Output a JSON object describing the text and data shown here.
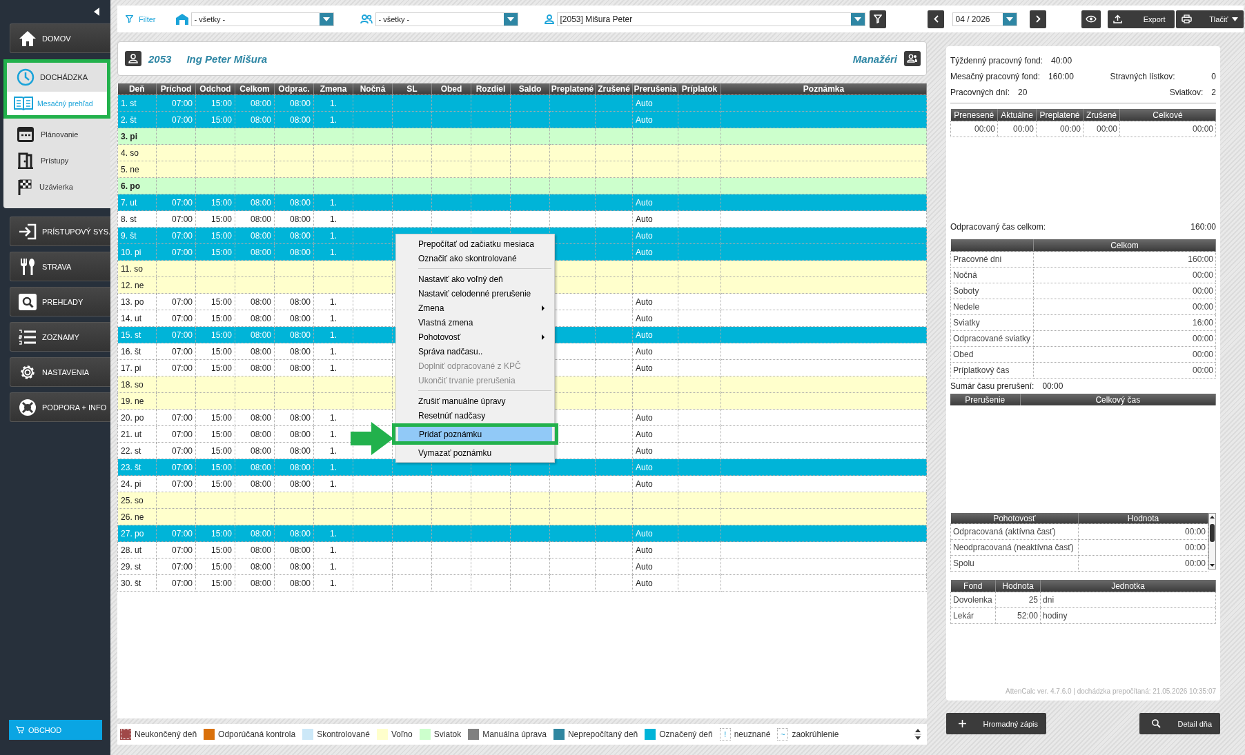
{
  "nav": [
    {
      "label": "DOMOV",
      "expanded": false
    },
    {
      "label": "DOCHÁDZKA",
      "expanded": true,
      "children": [
        {
          "label": "Mesačný prehľad",
          "selected": true
        },
        {
          "label": "Plánovanie",
          "selected": false
        },
        {
          "label": "Prístupy",
          "selected": false
        },
        {
          "label": "Uzávierka",
          "selected": false
        }
      ]
    },
    {
      "label": "PRÍSTUPOVÝ SYS.",
      "expanded": false
    },
    {
      "label": "STRAVA",
      "expanded": false
    },
    {
      "label": "PREHĽADY",
      "expanded": false
    },
    {
      "label": "ZOZNAMY",
      "expanded": false
    },
    {
      "label": "NASTAVENIA",
      "expanded": false
    },
    {
      "label": "PODPORA + INFO",
      "expanded": false
    }
  ],
  "shop_button": "OBCHOD",
  "toolbar": {
    "filter_label": "Filter",
    "location_select": "- všetky -",
    "group_select": "- všetky -",
    "employee_select": "[2053] Mišura Peter",
    "month": "04 / 2026",
    "export_label": "Export",
    "print_label": "Tlačiť"
  },
  "employee": {
    "id": "2053",
    "name": "Ing Peter Mišura",
    "managers_label": "Manažéri"
  },
  "table": {
    "columns": [
      "Deň",
      "Príchod",
      "Odchod",
      "Celkom",
      "Odprac.",
      "Zmena",
      "Nočná",
      "SL",
      "Obed",
      "Rozdiel",
      "Saldo",
      "Preplatené",
      "Zrušené",
      "Prerušenia",
      "Príplatok",
      "Poznámka"
    ],
    "rows": [
      {
        "day": "1. st",
        "kind": "marked",
        "arrival": "07:00",
        "departure": "15:00",
        "total": "08:00",
        "worked": "08:00",
        "shift": "1.",
        "interruption": "Auto"
      },
      {
        "day": "2. št",
        "kind": "marked",
        "arrival": "07:00",
        "departure": "15:00",
        "total": "08:00",
        "worked": "08:00",
        "shift": "1.",
        "interruption": "Auto"
      },
      {
        "day": "3. pi",
        "kind": "holiday"
      },
      {
        "day": "4. so",
        "kind": "free"
      },
      {
        "day": "5. ne",
        "kind": "free"
      },
      {
        "day": "6. po",
        "kind": "holiday"
      },
      {
        "day": "7. ut",
        "kind": "marked",
        "arrival": "07:00",
        "departure": "15:00",
        "total": "08:00",
        "worked": "08:00",
        "shift": "1.",
        "interruption": "Auto"
      },
      {
        "day": "8. st",
        "kind": "normal",
        "arrival": "07:00",
        "departure": "15:00",
        "total": "08:00",
        "worked": "08:00",
        "shift": "1.",
        "interruption": "Auto"
      },
      {
        "day": "9. št",
        "kind": "marked",
        "arrival": "07:00",
        "departure": "15:00",
        "total": "08:00",
        "worked": "08:00",
        "shift": "1.",
        "interruption": "Auto"
      },
      {
        "day": "10. pi",
        "kind": "marked",
        "arrival": "07:00",
        "departure": "15:00",
        "total": "08:00",
        "worked": "08:00",
        "shift": "1.",
        "interruption": "Auto"
      },
      {
        "day": "11. so",
        "kind": "free"
      },
      {
        "day": "12. ne",
        "kind": "free"
      },
      {
        "day": "13. po",
        "kind": "normal",
        "arrival": "07:00",
        "departure": "15:00",
        "total": "08:00",
        "worked": "08:00",
        "shift": "1.",
        "interruption": "Auto"
      },
      {
        "day": "14. ut",
        "kind": "normal",
        "arrival": "07:00",
        "departure": "15:00",
        "total": "08:00",
        "worked": "08:00",
        "shift": "1.",
        "interruption": "Auto"
      },
      {
        "day": "15. st",
        "kind": "marked",
        "arrival": "07:00",
        "departure": "15:00",
        "total": "08:00",
        "worked": "08:00",
        "shift": "1.",
        "interruption": "Auto"
      },
      {
        "day": "16. št",
        "kind": "normal",
        "arrival": "07:00",
        "departure": "15:00",
        "total": "08:00",
        "worked": "08:00",
        "shift": "1.",
        "interruption": "Auto"
      },
      {
        "day": "17. pi",
        "kind": "normal",
        "arrival": "07:00",
        "departure": "15:00",
        "total": "08:00",
        "worked": "08:00",
        "shift": "1.",
        "interruption": "Auto"
      },
      {
        "day": "18. so",
        "kind": "free"
      },
      {
        "day": "19. ne",
        "kind": "free"
      },
      {
        "day": "20. po",
        "kind": "normal",
        "arrival": "07:00",
        "departure": "15:00",
        "total": "08:00",
        "worked": "08:00",
        "shift": "1.",
        "interruption": "Auto"
      },
      {
        "day": "21. ut",
        "kind": "normal",
        "arrival": "07:00",
        "departure": "15:00",
        "total": "08:00",
        "worked": "08:00",
        "shift": "1.",
        "interruption": "Auto"
      },
      {
        "day": "22. st",
        "kind": "normal",
        "arrival": "07:00",
        "departure": "15:00",
        "total": "08:00",
        "worked": "08:00",
        "shift": "1.",
        "interruption": "Auto"
      },
      {
        "day": "23. št",
        "kind": "marked",
        "arrival": "07:00",
        "departure": "15:00",
        "total": "08:00",
        "worked": "08:00",
        "shift": "1.",
        "interruption": "Auto"
      },
      {
        "day": "24. pi",
        "kind": "normal",
        "arrival": "07:00",
        "departure": "15:00",
        "total": "08:00",
        "worked": "08:00",
        "shift": "1.",
        "interruption": "Auto"
      },
      {
        "day": "25. so",
        "kind": "free"
      },
      {
        "day": "26. ne",
        "kind": "free"
      },
      {
        "day": "27. po",
        "kind": "marked",
        "arrival": "07:00",
        "departure": "15:00",
        "total": "08:00",
        "worked": "08:00",
        "shift": "1.",
        "interruption": "Auto"
      },
      {
        "day": "28. ut",
        "kind": "normal",
        "arrival": "07:00",
        "departure": "15:00",
        "total": "08:00",
        "worked": "08:00",
        "shift": "1.",
        "interruption": "Auto"
      },
      {
        "day": "29. st",
        "kind": "normal",
        "arrival": "07:00",
        "departure": "15:00",
        "total": "08:00",
        "worked": "08:00",
        "shift": "1.",
        "interruption": "Auto"
      },
      {
        "day": "30. št",
        "kind": "normal",
        "arrival": "07:00",
        "departure": "15:00",
        "total": "08:00",
        "worked": "08:00",
        "shift": "1.",
        "interruption": "Auto"
      }
    ]
  },
  "context_menu": [
    {
      "kind": "item",
      "label": "Prepočítať od začiatku mesiaca",
      "disabled": false,
      "submenu": false,
      "selected": false
    },
    {
      "kind": "item",
      "label": "Označiť ako skontrolované",
      "disabled": false,
      "submenu": false,
      "selected": false
    },
    {
      "kind": "separator"
    },
    {
      "kind": "item",
      "label": "Nastaviť ako voľný deň",
      "disabled": false,
      "submenu": false,
      "selected": false
    },
    {
      "kind": "item",
      "label": "Nastaviť celodenné prerušenie",
      "disabled": false,
      "submenu": false,
      "selected": false
    },
    {
      "kind": "item",
      "label": "Zmena",
      "disabled": false,
      "submenu": true,
      "selected": false
    },
    {
      "kind": "item",
      "label": "Vlastná zmena",
      "disabled": false,
      "submenu": false,
      "selected": false
    },
    {
      "kind": "item",
      "label": "Pohotovosť",
      "disabled": false,
      "submenu": true,
      "selected": false
    },
    {
      "kind": "item",
      "label": "Správa nadčasu..",
      "disabled": false,
      "submenu": false,
      "selected": false
    },
    {
      "kind": "item",
      "label": "Doplniť odpracované z KPČ",
      "disabled": true,
      "submenu": false,
      "selected": false
    },
    {
      "kind": "item",
      "label": "Ukončiť trvanie prerušenia",
      "disabled": true,
      "submenu": false,
      "selected": false
    },
    {
      "kind": "separator"
    },
    {
      "kind": "item",
      "label": "Zrušiť manuálne úpravy",
      "disabled": false,
      "submenu": false,
      "selected": false
    },
    {
      "kind": "item",
      "label": "Resetnúť nadčasy",
      "disabled": false,
      "submenu": false,
      "selected": false
    },
    {
      "kind": "item",
      "label": "Pridať poznámku",
      "disabled": false,
      "submenu": false,
      "selected": true
    },
    {
      "kind": "item",
      "label": "Vymazať poznámku",
      "disabled": false,
      "submenu": false,
      "selected": false
    }
  ],
  "summary": {
    "stats": [
      {
        "label": "Týždenný pracovný fond:",
        "value": "40:00"
      },
      {
        "label": "Mesačný pracovný fond:",
        "value": "160:00"
      },
      {
        "label": "Stravných lístkov:",
        "value": "0"
      },
      {
        "label": "Pracovných dní:",
        "value": "20"
      },
      {
        "label": "Sviatkov:",
        "value": "2"
      }
    ],
    "overtime_table": {
      "columns": [
        "Prenesené",
        "Aktuálne",
        "Preplatené",
        "Zrušené",
        "Celkové"
      ],
      "values": [
        "00:00",
        "00:00",
        "00:00",
        "00:00",
        "00:00"
      ]
    },
    "worked_total": {
      "label": "Odpracovaný čas celkom:",
      "value": "160:00"
    },
    "totals_table": {
      "columns": [
        "Celkom"
      ],
      "rows": [
        {
          "label": "Pracovné dni",
          "value": "160:00"
        },
        {
          "label": "Nočná",
          "value": "00:00"
        },
        {
          "label": "Soboty",
          "value": "00:00"
        },
        {
          "label": "Nedele",
          "value": "00:00"
        },
        {
          "label": "Sviatky",
          "value": "16:00"
        },
        {
          "label": "Odpracované sviatky",
          "value": "00:00"
        },
        {
          "label": "Obed",
          "value": "00:00"
        },
        {
          "label": "Príplatkový čas",
          "value": "00:00"
        }
      ]
    },
    "interruptions_total": {
      "label": "Sumár času prerušení:",
      "value": "00:00"
    },
    "interruptions_table": {
      "columns": [
        "Prerušenie",
        "Celkový čas"
      ]
    },
    "standby_table": {
      "columns": [
        "Pohotovosť",
        "Hodnota"
      ],
      "rows": [
        {
          "label": "Odpracovaná (aktívna časť)",
          "value": "00:00"
        },
        {
          "label": "Neodpracovaná (neaktívna časť)",
          "value": "00:00"
        },
        {
          "label": "Spolu",
          "value": "00:00"
        }
      ]
    },
    "fund_table": {
      "columns": [
        "Fond",
        "Hodnota",
        "Jednotka"
      ],
      "rows": [
        {
          "label": "Dovolenka",
          "value": "25",
          "unit": "dni"
        },
        {
          "label": "Lekár",
          "value": "52:00",
          "unit": "hodiny"
        }
      ]
    },
    "version": "AttenCalc ver. 4.7.6.0 | dochádzka prepočítaná: 21.05.2026 10:35:07"
  },
  "bulk_button": "Hromadný zápis",
  "day_detail_button": "Detail dňa",
  "legend": [
    {
      "kind": "swatch",
      "label": "Neukončený deň",
      "color": "#a04848"
    },
    {
      "kind": "swatch",
      "label": "Odporúčaná kontrola",
      "color": "#d9700a"
    },
    {
      "kind": "swatch",
      "label": "Skontrolované",
      "color": "#cce8f8"
    },
    {
      "kind": "swatch",
      "label": "Voľno",
      "color": "#ffffcc"
    },
    {
      "kind": "swatch",
      "label": "Sviatok",
      "color": "#ccffcc"
    },
    {
      "kind": "swatch",
      "label": "Manuálna úprava",
      "color": "#808080"
    },
    {
      "kind": "swatch",
      "label": "Neprepočítaný deň",
      "color": "#2f86a0"
    },
    {
      "kind": "swatch",
      "label": "Označený deň",
      "color": "#00b4d8"
    },
    {
      "kind": "symbol",
      "symbol": "!",
      "label": "neuznané"
    },
    {
      "kind": "symbol",
      "symbol": "~",
      "label": "zaokrúhlenie"
    }
  ]
}
